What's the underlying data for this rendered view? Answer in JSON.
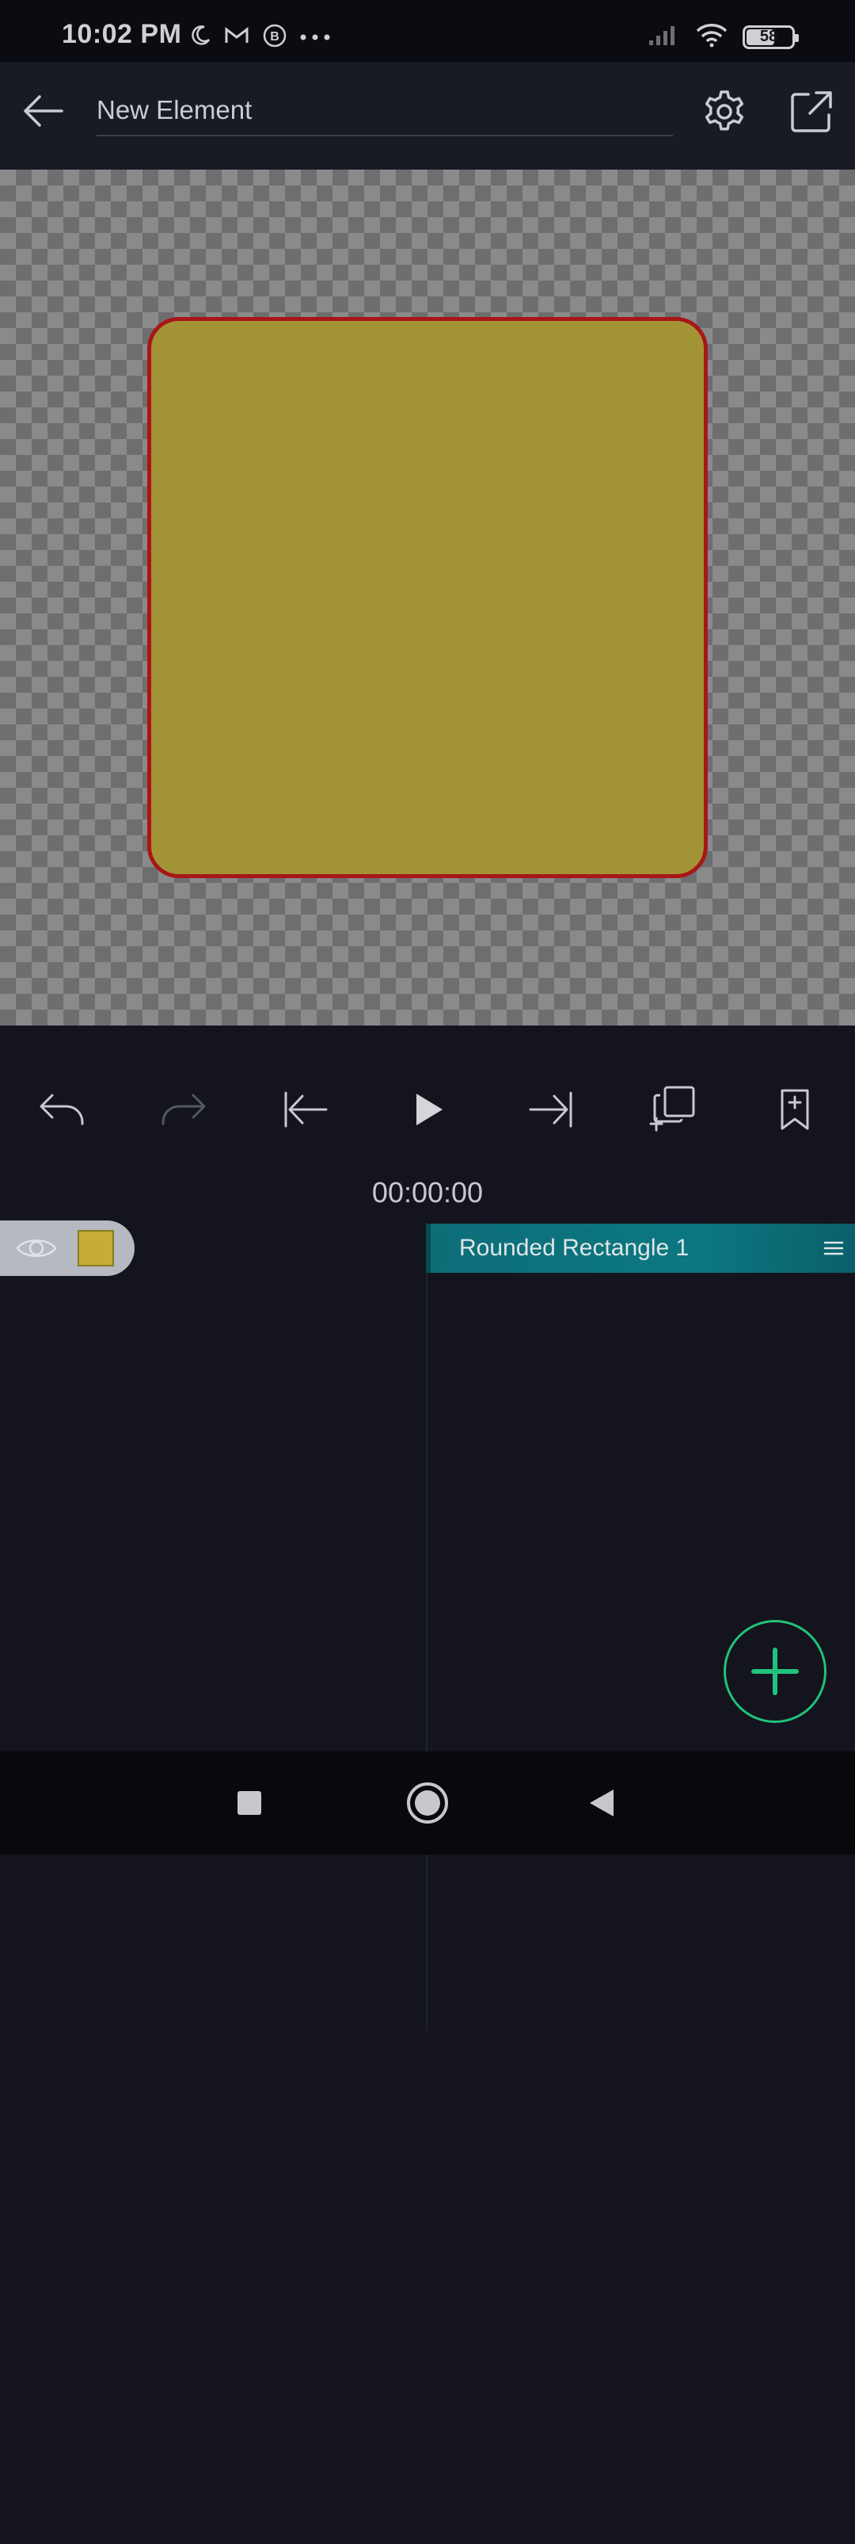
{
  "status_bar": {
    "time": "10:02 PM",
    "left_icons": [
      "moon-icon",
      "gmail-icon",
      "b-icon",
      "more-dots-icon"
    ],
    "right_icons": [
      "signal-icon",
      "wifi-icon",
      "battery-icon"
    ],
    "battery_level": "58"
  },
  "app_bar": {
    "title": "New Element",
    "back_icon": "arrow-left-icon",
    "settings_icon": "gear-icon",
    "export_icon": "external-link-icon"
  },
  "canvas": {
    "background": "checkerboard",
    "shape": {
      "type": "rounded-rectangle",
      "fill_color": "#a39337",
      "stroke_color": "#a81616"
    }
  },
  "toolbar": {
    "buttons": [
      {
        "name": "undo",
        "icon": "undo-icon",
        "enabled": true
      },
      {
        "name": "redo",
        "icon": "redo-icon",
        "enabled": false
      },
      {
        "name": "jump-to-start",
        "icon": "skip-start-icon",
        "enabled": true
      },
      {
        "name": "play",
        "icon": "play-icon",
        "enabled": true
      },
      {
        "name": "jump-to-end",
        "icon": "skip-end-icon",
        "enabled": true
      },
      {
        "name": "duplicate",
        "icon": "duplicate-icon",
        "enabled": true
      },
      {
        "name": "bookmark",
        "icon": "bookmark-add-icon",
        "enabled": true
      }
    ]
  },
  "timeline": {
    "timecode": "00:00:00",
    "layers": [
      {
        "name": "Rounded Rectangle 1",
        "color": "#c6ad38",
        "clip_color": "#0c7781",
        "visible": true
      }
    ]
  },
  "fab": {
    "icon": "plus-icon",
    "accent_color": "#21c27c"
  },
  "nav_bar": {
    "buttons": [
      "recents-square-icon",
      "home-circle-icon",
      "back-triangle-icon"
    ]
  },
  "colors": {
    "app_background": "#13141d",
    "app_bar": "#181a24",
    "accent": "#21c27c",
    "clip": "#0c7781"
  }
}
